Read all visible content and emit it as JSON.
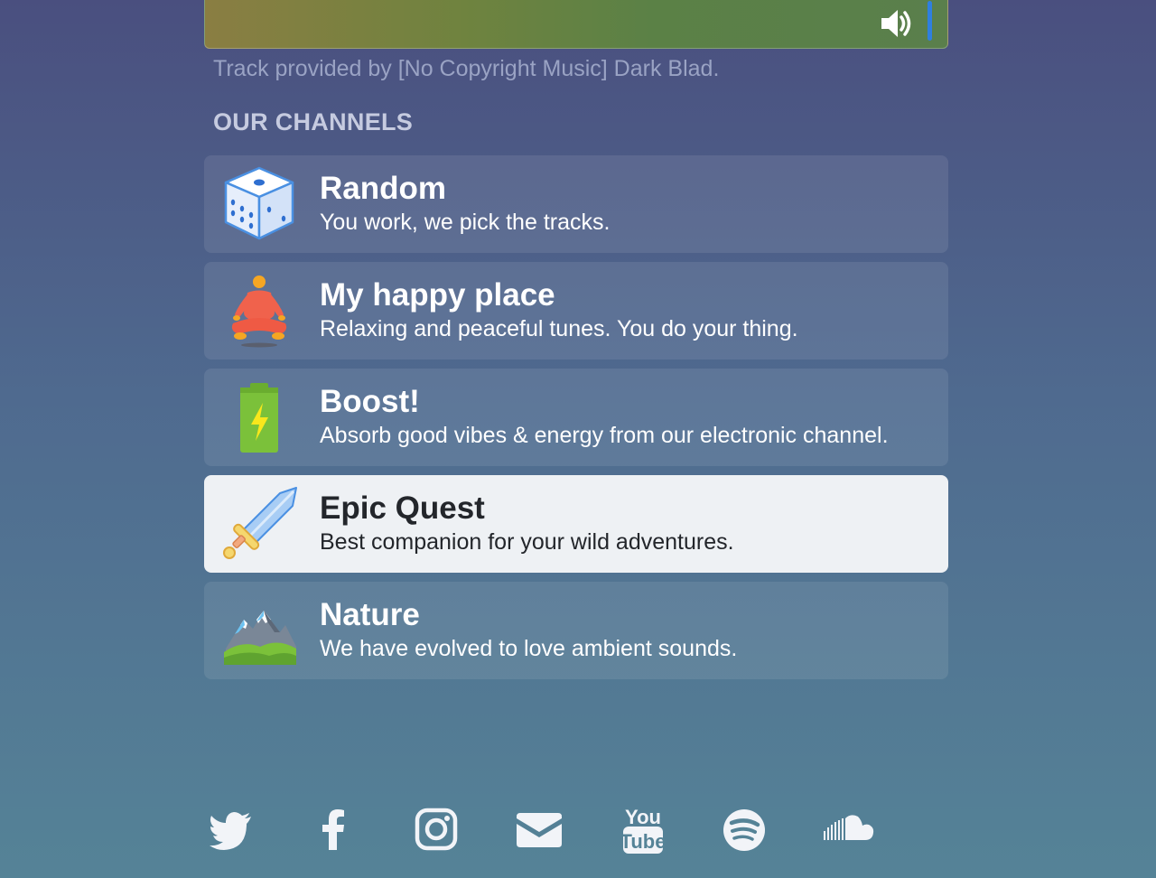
{
  "player": {
    "volume_icon": "volume-icon",
    "volume_color": "#2f7fe0"
  },
  "credit_text": "Track provided by [No Copyright Music] Dark Blad.",
  "section_title": "OUR CHANNELS",
  "channels": [
    {
      "name": "Random",
      "description": "You work, we pick the tracks.",
      "icon": "dice-icon",
      "active": false
    },
    {
      "name": "My happy place",
      "description": "Relaxing and peaceful tunes. You do your thing.",
      "icon": "meditation-icon",
      "active": false
    },
    {
      "name": "Boost!",
      "description": "Absorb good vibes & energy from our electronic channel.",
      "icon": "battery-icon",
      "active": false
    },
    {
      "name": "Epic Quest",
      "description": "Best companion for your wild adventures.",
      "icon": "sword-icon",
      "active": true
    },
    {
      "name": "Nature",
      "description": "We have evolved to love ambient sounds.",
      "icon": "mountain-icon",
      "active": false
    }
  ],
  "socials": [
    {
      "icon": "twitter-icon"
    },
    {
      "icon": "facebook-icon"
    },
    {
      "icon": "instagram-icon"
    },
    {
      "icon": "email-icon"
    },
    {
      "icon": "youtube-icon",
      "label_top": "You",
      "label_bottom": "Tube"
    },
    {
      "icon": "spotify-icon"
    },
    {
      "icon": "soundcloud-icon"
    }
  ],
  "colors": {
    "active_card": "#eef1f4",
    "social_icon": "#f2f4f8"
  }
}
